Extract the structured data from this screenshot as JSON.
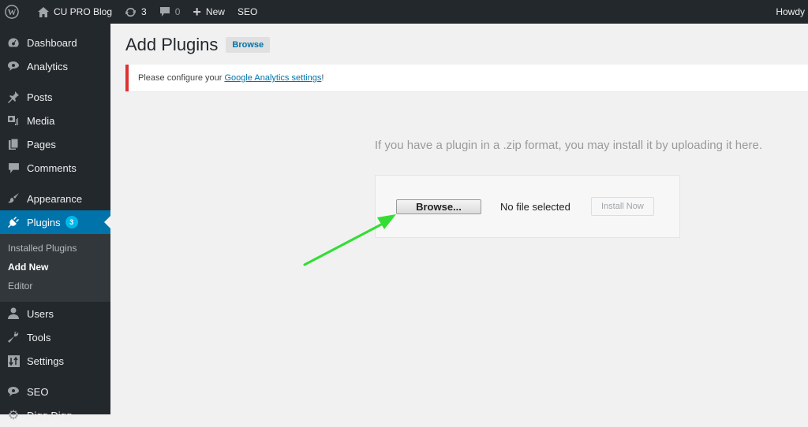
{
  "admin_bar": {
    "site_name": "CU PRO Blog",
    "updates_count": "3",
    "comments_count": "0",
    "new_label": "New",
    "seo_label": "SEO",
    "account_label": "Howdy"
  },
  "sidebar": {
    "items": [
      {
        "label": "Dashboard",
        "icon": "dashboard-icon"
      },
      {
        "label": "Analytics",
        "icon": "analytics-icon"
      },
      {
        "label": "Posts",
        "icon": "pin-icon"
      },
      {
        "label": "Media",
        "icon": "media-icon"
      },
      {
        "label": "Pages",
        "icon": "pages-icon"
      },
      {
        "label": "Comments",
        "icon": "comment-icon"
      },
      {
        "label": "Appearance",
        "icon": "brush-icon"
      },
      {
        "label": "Plugins",
        "icon": "plug-icon",
        "badge": "3",
        "active": true
      },
      {
        "label": "Users",
        "icon": "user-icon"
      },
      {
        "label": "Tools",
        "icon": "wrench-icon"
      },
      {
        "label": "Settings",
        "icon": "settings-icon"
      },
      {
        "label": "SEO",
        "icon": "seo-icon"
      },
      {
        "label": "Digg Digg",
        "icon": "gear-icon"
      }
    ],
    "plugins_submenu": [
      {
        "label": "Installed Plugins"
      },
      {
        "label": "Add New",
        "current": true
      },
      {
        "label": "Editor"
      }
    ]
  },
  "main": {
    "title": "Add Plugins",
    "title_action": "Browse",
    "notice": {
      "prefix": "Please configure your ",
      "link": "Google Analytics settings",
      "suffix": "!"
    },
    "upload_help": "If you have a plugin in a .zip format, you may install it by uploading it here.",
    "file_input": {
      "button_label": "Browse...",
      "status": "No file selected"
    },
    "install_button": "Install Now"
  },
  "colors": {
    "admin_bar_bg": "#23282d",
    "accent": "#0073aa",
    "badge": "#00b9eb",
    "notice_error": "#dc3232",
    "annotation_arrow": "#33dd33"
  }
}
